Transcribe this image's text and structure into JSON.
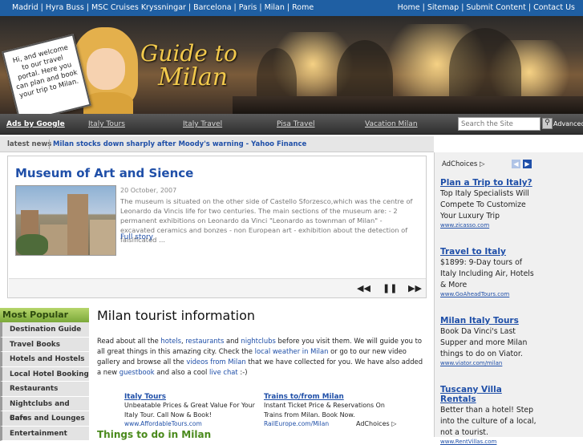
{
  "topbar": {
    "left_links": [
      "Madrid",
      "Hyra Buss",
      "MSC Cruises Kryssningar",
      "Barcelona",
      "Paris",
      "Milan",
      "Rome"
    ],
    "right_links": [
      "Home",
      "Sitemap",
      "Submit Content",
      "Contact Us"
    ]
  },
  "banner": {
    "sign_text": "Hi, and welcome to our travel portal. Here you can plan and book your trip to Milan.",
    "logo_line1": "Guide to",
    "logo_line2": "Milan"
  },
  "nav": {
    "ads_label": "Ads by Google",
    "links": [
      "Italy Tours",
      "Italy Travel",
      "Pisa Travel",
      "Vacation Milan"
    ],
    "search_placeholder": "Search the Site",
    "advanced_label": "Advanced"
  },
  "news": {
    "label": "latest news",
    "headline": "Milan stocks down sharply after Moody's warning - Yahoo Finance"
  },
  "feature": {
    "title": "Museum of Art and Sience",
    "date": "20 October, 2007",
    "text": "The museum is situated on the other side of Castello Sforzesco,which was the centre of Leonardo da Vincis life for two centuries. The main sections of the museum are: - 2 permanent exhibitions on Leonardo da Vinci \"Leonardo as townman of Milan\" - excavated ceramics and bonzes - non European art - exhibition about the detection of falsificated ...",
    "link": "Full story",
    "controls": {
      "prev": "◀◀",
      "pause": "❚❚",
      "next": "▶▶"
    }
  },
  "sidebar": {
    "heading": "Most Popular",
    "items": [
      "Destination Guide",
      "Travel Books",
      "Hotels and Hostels",
      "Local Hotel Booking",
      "Restaurants",
      "Nightclubs and Bars",
      "Cafes and Lounges",
      "Entertainment"
    ]
  },
  "content": {
    "heading": "Milan tourist information",
    "p1": "Read about all the ",
    "l_hotels": "hotels",
    "p2": ", ",
    "l_restaurants": "restaurants",
    "p3": " and ",
    "l_nightclubs": "nightclubs",
    "p4": " before you visit them. We will guide you to all great things in this amazing city. Check the ",
    "l_weather": "local weather in Milan",
    "p5": " or go to our new video gallery and browse all the ",
    "l_videos": "videos from Milan",
    "p6": " that we have collected for you. We have also added a new ",
    "l_guestbook": "guestbook",
    "p7": " and also a cool ",
    "l_chat": "live chat",
    "p8": " :-)",
    "ads": [
      {
        "title": "Italy Tours",
        "desc": "Unbeatable Prices & Great Value For Your Italy Tour. Call Now & Book!",
        "url": "www.AffordableTours.com"
      },
      {
        "title": "Trains to/from Milan",
        "desc": "Instant Ticket Price & Reservations On Trains from Milan. Book Now.",
        "url": "RailEurope.com/Milan"
      }
    ],
    "adchoices": "AdChoices ▷",
    "things_heading": "Things to do in Milan"
  },
  "right_ads": {
    "adchoices": "AdChoices ▷",
    "prev": "◀",
    "next": "▶",
    "items": [
      {
        "title": "Plan a Trip to Italy?",
        "desc": "Top Italy Specialists Will Compete To Customize Your Luxury Trip",
        "url": "www.zicasso.com"
      },
      {
        "title": "Travel to Italy",
        "desc": "$1899: 9-Day tours of Italy Including Air, Hotels & More",
        "url": "www.GoAheadTours.com"
      },
      {
        "title": "Milan Italy Tours",
        "desc": "Book Da Vinci's Last Supper and more Milan things to do on Viator.",
        "url": "www.viator.com/milan"
      },
      {
        "title": "Tuscany Villa Rentals",
        "desc": "Better than a hotel! Step into the culture of a local, not a tourist.",
        "url": "www.RentVillas.com"
      }
    ]
  },
  "colors": {
    "topbar": "#1f5fa3",
    "link": "#1f4fa8",
    "green_heading": "#4a8a1c"
  }
}
